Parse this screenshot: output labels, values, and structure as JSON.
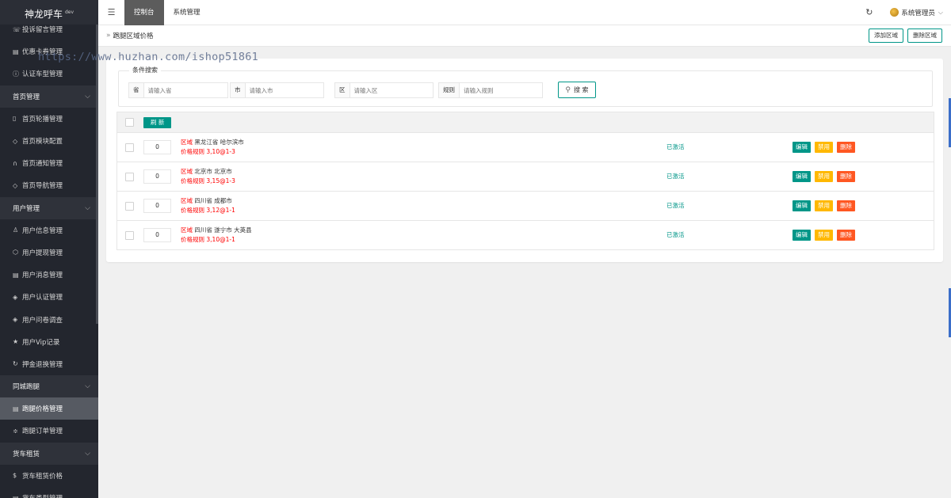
{
  "brand": {
    "title": "神龙呼车",
    "sup": "dev"
  },
  "sidebar": {
    "items": [
      {
        "label": "投诉留言管理",
        "icon": "☏",
        "type": "item"
      },
      {
        "label": "优惠卡券管理",
        "icon": "▤",
        "type": "item"
      },
      {
        "label": "认证车型管理",
        "icon": "ⓘ",
        "type": "item"
      },
      {
        "label": "首页管理",
        "icon": "",
        "type": "group"
      },
      {
        "label": "首页轮播管理",
        "icon": "▯",
        "type": "item"
      },
      {
        "label": "首页模块配置",
        "icon": "◇",
        "type": "item"
      },
      {
        "label": "首页通知管理",
        "icon": "∩",
        "type": "item"
      },
      {
        "label": "首页导航管理",
        "icon": "◇",
        "type": "item"
      },
      {
        "label": "用户管理",
        "icon": "",
        "type": "group"
      },
      {
        "label": "用户信息管理",
        "icon": "♙",
        "type": "item"
      },
      {
        "label": "用户提现管理",
        "icon": "⬡",
        "type": "item"
      },
      {
        "label": "用户消息管理",
        "icon": "▤",
        "type": "item"
      },
      {
        "label": "用户认证管理",
        "icon": "◈",
        "type": "item"
      },
      {
        "label": "用户问卷调查",
        "icon": "◈",
        "type": "item"
      },
      {
        "label": "用户Vip记录",
        "icon": "★",
        "type": "item"
      },
      {
        "label": "押金退换管理",
        "icon": "↻",
        "type": "item"
      },
      {
        "label": "同城跑腿",
        "icon": "",
        "type": "group"
      },
      {
        "label": "跑腿价格管理",
        "icon": "▤",
        "type": "active"
      },
      {
        "label": "跑腿订单管理",
        "icon": "≑",
        "type": "item"
      },
      {
        "label": "货车租赁",
        "icon": "",
        "type": "group"
      },
      {
        "label": "货车租赁价格",
        "icon": "$",
        "type": "item"
      },
      {
        "label": "货车类型管理",
        "icon": "▤",
        "type": "item"
      }
    ]
  },
  "topbar": {
    "menu_icon": "☰",
    "tabs": [
      "控制台",
      "系统管理"
    ],
    "refresh_icon": "↻",
    "user": "系统管理员",
    "caret": "⌵"
  },
  "crumb": {
    "arrow": "»",
    "title": "跑腿区域价格",
    "add_label": "添加区域",
    "delete_label": "删除区域"
  },
  "watermark": "https://www.huzhan.com/ishop51861",
  "search": {
    "legend": "条件搜索",
    "fields": [
      {
        "label": "省",
        "placeholder": "请输入省"
      },
      {
        "label": "市",
        "placeholder": "请输入市"
      },
      {
        "label": "区",
        "placeholder": "请输入区"
      },
      {
        "label": "规则",
        "placeholder": "请输入规则"
      }
    ],
    "button_icon": "⚲",
    "button_label": "搜 索"
  },
  "table": {
    "refresh_label": "刷 新",
    "region_label": "区域",
    "rule_label": "价格规则",
    "rows": [
      {
        "sort": "0",
        "region": "黑龙江省 哈尔滨市",
        "rule": "3,10@1-3",
        "status": "已激活"
      },
      {
        "sort": "0",
        "region": "北京市 北京市",
        "rule": "3,15@1-3",
        "status": "已激活"
      },
      {
        "sort": "0",
        "region": "四川省 成都市",
        "rule": "3,12@1-1",
        "status": "已激活"
      },
      {
        "sort": "0",
        "region": "四川省 遂宁市 大英县",
        "rule": "3,10@1-1",
        "status": "已激活"
      }
    ],
    "ops": {
      "edit": "编辑",
      "disable": "禁用",
      "delete": "删除"
    }
  },
  "colors": {
    "accent": "#009688",
    "warn": "#ffb800",
    "danger": "#ff5722",
    "sidebar": "#23262e"
  }
}
